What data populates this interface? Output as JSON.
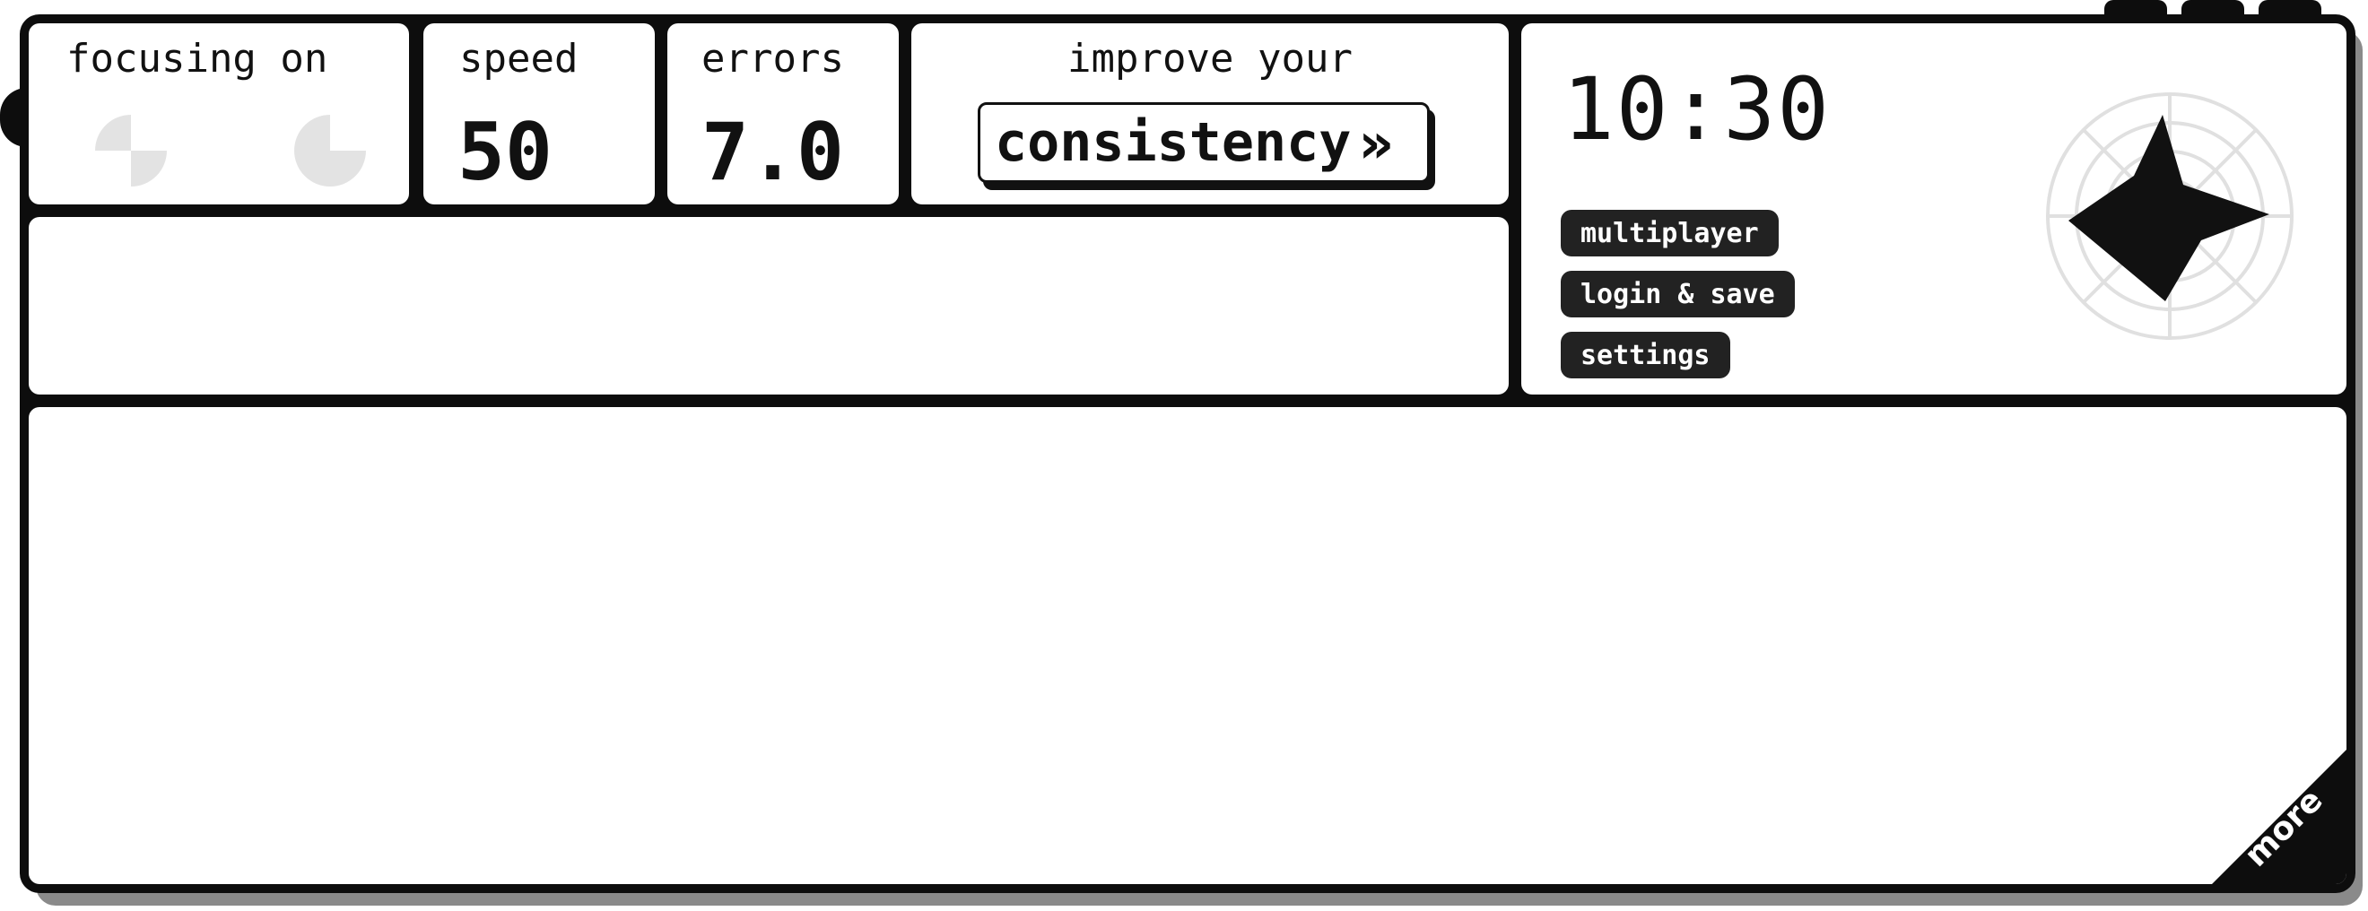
{
  "stats": {
    "focusing_label": "focusing on",
    "speed_label": "speed",
    "speed_value": "50",
    "errors_label": "errors",
    "errors_value": "7.0"
  },
  "improve": {
    "heading": "improve your",
    "button_label": "consistency",
    "button_icon": "double-chevron-right-icon"
  },
  "clock": {
    "time": "10:30"
  },
  "menu": {
    "multiplayer": "multiplayer",
    "login": "login & save",
    "settings": "settings"
  },
  "corner": {
    "more_label": "more"
  },
  "colors": {
    "frame": "#0d0d0d",
    "panel": "#ffffff",
    "pill_bg": "#222222",
    "pill_text": "#ffffff",
    "icon_gray": "#e3e3e3",
    "shadow": "#8a8a8a"
  }
}
